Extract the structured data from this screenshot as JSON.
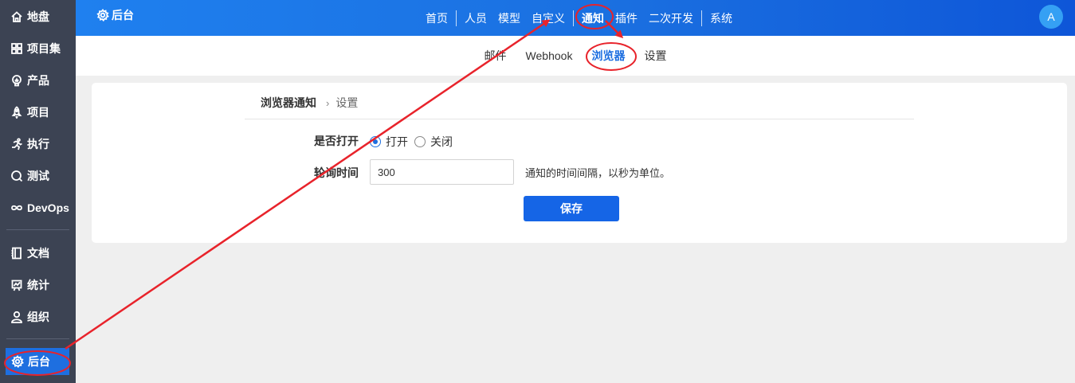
{
  "sidebar": {
    "items": [
      {
        "label": "地盘",
        "icon": "home-icon"
      },
      {
        "label": "项目集",
        "icon": "grid-icon"
      },
      {
        "label": "产品",
        "icon": "bulb-icon"
      },
      {
        "label": "项目",
        "icon": "rocket-icon"
      },
      {
        "label": "执行",
        "icon": "run-icon"
      },
      {
        "label": "测试",
        "icon": "search-icon"
      },
      {
        "label": "DevOps",
        "icon": "infinity-icon"
      },
      {
        "label": "文档",
        "icon": "book-icon"
      },
      {
        "label": "统计",
        "icon": "chart-icon"
      },
      {
        "label": "组织",
        "icon": "user-icon"
      }
    ],
    "active": {
      "label": "后台",
      "icon": "gear-icon"
    }
  },
  "header": {
    "title": "后台",
    "nav": [
      "首页",
      "人员",
      "模型",
      "自定义",
      "通知",
      "插件",
      "二次开发",
      "系统"
    ],
    "active_nav": "通知",
    "avatar": "A"
  },
  "subnav": {
    "items": [
      "邮件",
      "Webhook",
      "浏览器",
      "设置"
    ],
    "active": "浏览器"
  },
  "breadcrumb": {
    "parent": "浏览器通知",
    "separator": "›",
    "current": "设置"
  },
  "form": {
    "enable_label": "是否打开",
    "options": [
      {
        "label": "打开",
        "checked": true
      },
      {
        "label": "关闭",
        "checked": false
      }
    ],
    "interval_label": "轮询时间",
    "interval_value": "300",
    "interval_hint": "通知的时间间隔，以秒为单位。",
    "save_label": "保存"
  },
  "colors": {
    "sidebar_bg": "#3c4353",
    "accent": "#1e6fe0",
    "annotation": "#e8232b"
  }
}
